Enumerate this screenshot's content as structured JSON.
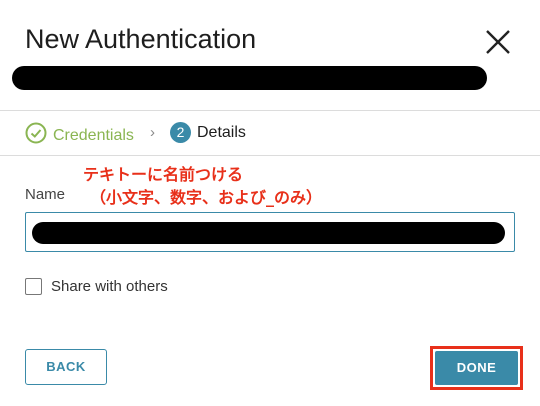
{
  "dialog": {
    "title": "New Authentication"
  },
  "steps": [
    {
      "label": "Credentials",
      "state": "complete"
    },
    {
      "number": "2",
      "label": "Details",
      "state": "current"
    }
  ],
  "annotation": {
    "line1": "テキトーに名前つける",
    "line2": "（小文字、数字、および_のみ）"
  },
  "form": {
    "name_label": "Name",
    "share_label": "Share with others",
    "share_checked": false
  },
  "buttons": {
    "back": "BACK",
    "done": "DONE"
  },
  "colors": {
    "accent": "#3a8aa8",
    "success": "#8ab552",
    "annotation_red": "#e8301a"
  }
}
